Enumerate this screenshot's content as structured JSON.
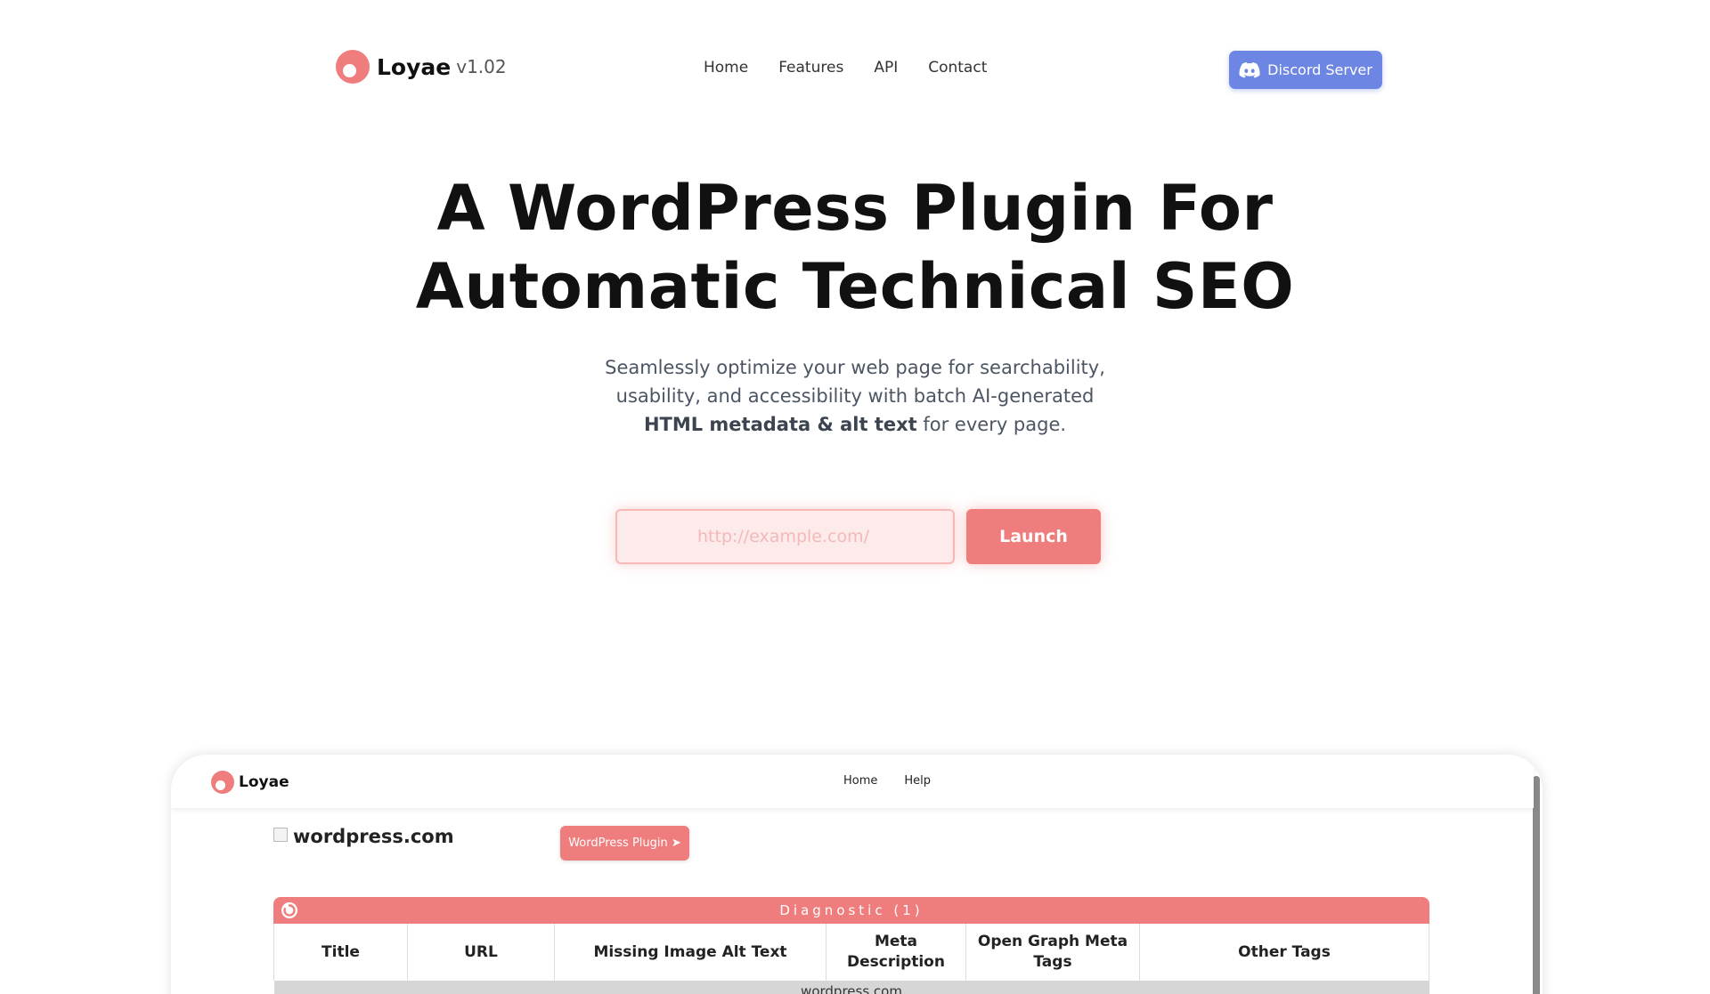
{
  "nav": {
    "brand": "Loyae",
    "version": "v1.02",
    "links": [
      "Home",
      "Features",
      "API",
      "Contact"
    ],
    "discord_label": "Discord Server"
  },
  "hero": {
    "title_line1": "A WordPress Plugin For",
    "title_line2": "Automatic Technical SEO",
    "subtitle_part1": "Seamlessly optimize your web page for searchability, usability, and accessibility with batch AI-generated ",
    "subtitle_bold": "HTML metadata & alt text",
    "subtitle_part2": " for every page.",
    "input_placeholder": "http://example.com/",
    "launch_label": "Launch"
  },
  "preview": {
    "brand": "Loyae",
    "links": [
      "Home",
      "Help"
    ],
    "site_name": "wordpress.com",
    "plugin_button": "WordPress Plugin ➤",
    "diagnostic_label": "Diagnostic (1)",
    "columns": [
      "Title",
      "URL",
      "Missing Image Alt Text",
      "Meta Description",
      "Open Graph Meta Tags",
      "Other Tags"
    ],
    "group_row": "wordpress.com"
  },
  "colors": {
    "accent": "#f07d7d",
    "discord": "#6d86e3"
  }
}
